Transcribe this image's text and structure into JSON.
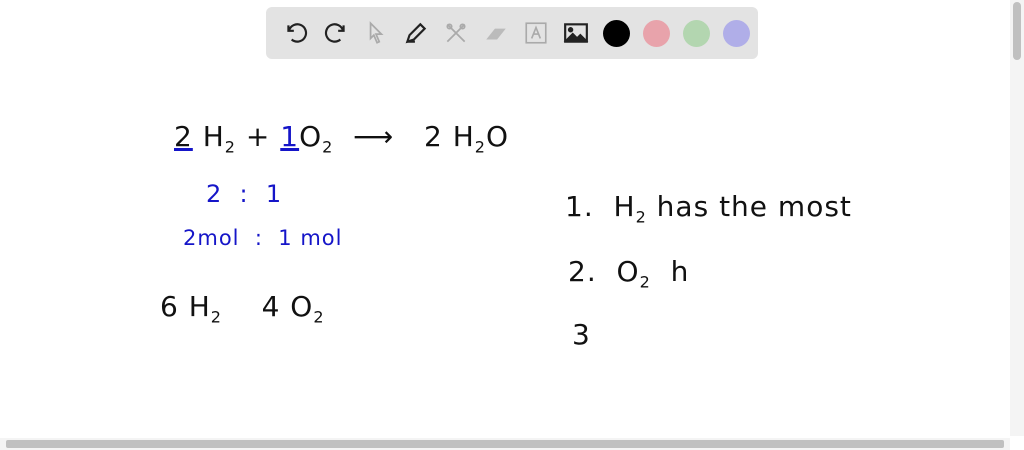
{
  "toolbar": {
    "tools": [
      "undo-icon",
      "redo-icon",
      "select-icon",
      "pen-icon",
      "tools-icon",
      "eraser-icon",
      "text-icon",
      "image-icon"
    ],
    "colors": [
      "#000000",
      "#e8a3ab",
      "#b3d6b0",
      "#b0aee8"
    ]
  },
  "board": {
    "eq": {
      "c1": "2",
      "h": "H",
      "s2a": "2",
      "plus": "+",
      "c2": "1",
      "o": "O",
      "s2b": "2",
      "arrow": "⟶",
      "prod": "2 H",
      "s2c": "2",
      "prodO": "O"
    },
    "ratio": "2  :  1",
    "mol": "2mol  :  1 mol",
    "given": {
      "a": "6 H",
      "as": "2",
      "b": "4 O",
      "bs": "2"
    },
    "list": [
      {
        "n": "1.",
        "t": "H",
        "s": "2",
        "rest": " has the most"
      },
      {
        "n": "2.",
        "t": "O",
        "s": "2",
        "rest": "  h"
      },
      {
        "n": "3",
        "t": "",
        "s": "",
        "rest": ""
      }
    ]
  }
}
